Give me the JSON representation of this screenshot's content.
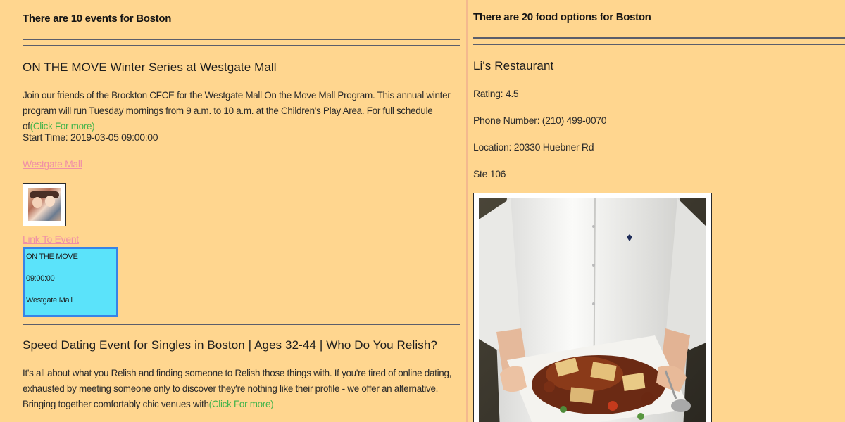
{
  "events": {
    "count_title": "There are 10 events for Boston",
    "items": [
      {
        "title": "ON THE MOVE Winter Series at Westgate Mall",
        "description": "Join our friends of the Brockton CFCE for the Westgate Mall On the Move Mall Program. This annual winter program will run Tuesday mornings from 9 a.m. to 10 a.m. at the Children's Play Area. For full schedule of",
        "more_label": "(Click For more)",
        "start_time": "Start Time: 2019-03-05 09:00:00",
        "venue_link": "Westgate Mall",
        "event_link": "Link To Event",
        "info_box": {
          "name": "ON THE MOVE",
          "time": "09:00:00",
          "venue": "Westgate Mall"
        }
      },
      {
        "title": "Speed Dating Event for Singles in Boston | Ages 32-44 | Who Do You Relish?",
        "description": "It's all about what you Relish and finding someone to Relish those things with. If you're tired of online dating, exhausted by meeting someone only to discover they're nothing like their profile - we offer an alternative.  Bringing together comfortably chic venues with",
        "more_label": "(Click For more)"
      }
    ]
  },
  "food": {
    "count_title": "There are 20 food options for Boston",
    "items": [
      {
        "name": "Li's Restaurant",
        "rating": "Rating: 4.5",
        "phone": "Phone Number: (210) 499-0070",
        "location": "Location: 20330 Huebner Rd",
        "address_line2": "Ste 106"
      }
    ]
  },
  "colors": {
    "page_background": "#ffd68f",
    "more_link": "#42b34a",
    "venue_link": "#f08fa6",
    "info_box_fill": "#5be3fa",
    "info_box_border": "#3783e6"
  }
}
